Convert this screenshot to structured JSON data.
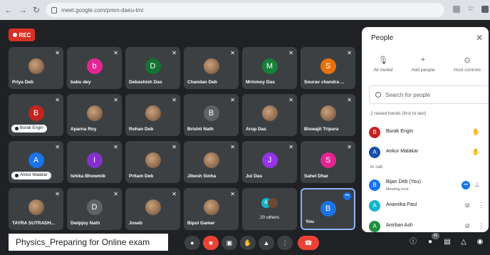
{
  "browser": {
    "url": "meet.google.com/pmm-daeu-tmi"
  },
  "meet": {
    "rec_label": "REC",
    "tiles": [
      {
        "name": "Priya Deb",
        "initial": "",
        "color": ""
      },
      {
        "name": "babu dey",
        "initial": "b",
        "color": "#e52592"
      },
      {
        "name": "Debashish Das",
        "initial": "D",
        "color": "#137333"
      },
      {
        "name": "Chandan Deb",
        "initial": "",
        "color": ""
      },
      {
        "name": "Mrinmoy Das",
        "initial": "M",
        "color": "#188038"
      },
      {
        "name": "Sourav chandra ...",
        "initial": "S",
        "color": "#e8710a"
      },
      {
        "name": "Burak Engin",
        "initial": "B",
        "color": "#c5221f"
      },
      {
        "name": "Aparna Roy",
        "initial": "",
        "color": ""
      },
      {
        "name": "Rohan Deb",
        "initial": "",
        "color": ""
      },
      {
        "name": "Brishti Nath",
        "initial": "B",
        "color": "#5f6368"
      },
      {
        "name": "Arup Das",
        "initial": "",
        "color": ""
      },
      {
        "name": "Biswajit Tripura",
        "initial": "",
        "color": ""
      },
      {
        "name": "Ankur Malakar",
        "initial": "A",
        "color": "#1a73e8"
      },
      {
        "name": "Ishika Bhowmik",
        "initial": "I",
        "color": "#8430ce"
      },
      {
        "name": "Pritam Deb",
        "initial": "",
        "color": ""
      },
      {
        "name": "Jibesh Sinha",
        "initial": "",
        "color": ""
      },
      {
        "name": "Jui Das",
        "initial": "J",
        "color": "#9334e6"
      },
      {
        "name": "Sahel Dhar",
        "initial": "S",
        "color": "#e52592"
      },
      {
        "name": "TAYRA SUTRADH...",
        "initial": "",
        "color": ""
      },
      {
        "name": "Dwipjoy Nath",
        "initial": "D",
        "color": "#5f6368"
      },
      {
        "name": "Joseb",
        "initial": "",
        "color": ""
      },
      {
        "name": "Bipul Gamer",
        "initial": "",
        "color": ""
      },
      {
        "name": "20 others",
        "initial": "A",
        "color": "#12b5cb"
      },
      {
        "name": "You",
        "initial": "B",
        "color": "#1a73e8"
      }
    ]
  },
  "bottom": {
    "meeting_title": "Physics_Preparing for Online exam",
    "participant_count": "42"
  },
  "people": {
    "title": "People",
    "actions": [
      {
        "label": "All muted",
        "icon": "mic-off-icon"
      },
      {
        "label": "Add people",
        "icon": "add-person-icon"
      },
      {
        "label": "Host controls",
        "icon": "host-controls-icon"
      }
    ],
    "search_placeholder": "Search for people",
    "raised_label": "2 raised hands (first to last)",
    "raised": [
      {
        "name": "Burak Engin",
        "initial": "B",
        "color": "#c5221f"
      },
      {
        "name": "Ankur Malakar",
        "initial": "A",
        "color": "#174ea6"
      }
    ],
    "in_call_label": "In call",
    "in_call": [
      {
        "name": "Bijan Deb (You)",
        "sub": "Meeting host",
        "initial": "B",
        "color": "#1a73e8"
      },
      {
        "name": "Anamika Paul",
        "sub": "",
        "initial": "A",
        "color": "#12b5cb"
      },
      {
        "name": "Anirban Ash",
        "sub": "",
        "initial": "A",
        "color": "#1e8e3e"
      }
    ]
  }
}
